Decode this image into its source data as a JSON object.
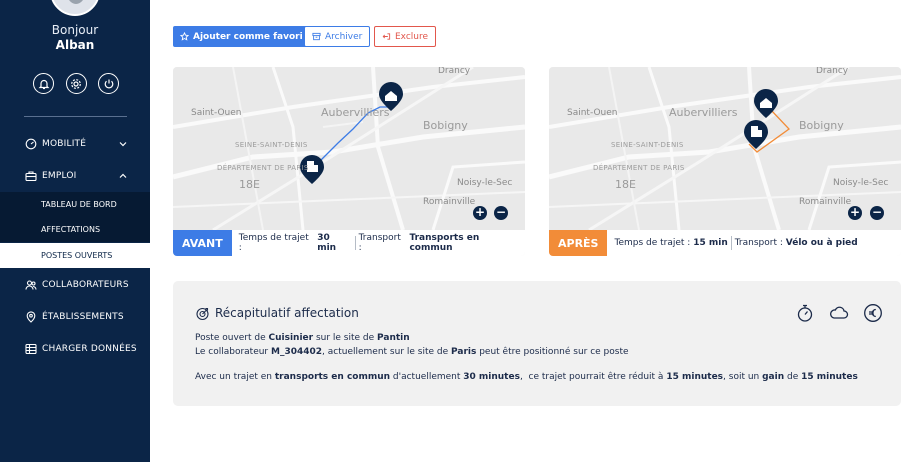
{
  "sidebar": {
    "greeting": "Bonjour",
    "user_name": "Alban",
    "menu": {
      "mobilite": "MOBILITÉ",
      "emploi": "EMPLOI",
      "tableau_de_bord": "TABLEAU DE BORD",
      "affectations": "AFFECTATIONS",
      "postes_ouverts": "POSTES OUVERTS",
      "collaborateurs": "COLLABORATEURS",
      "etablissements": "ÉTABLISSEMENTS",
      "charger_donnees": "CHARGER DONNÉES"
    }
  },
  "actions": {
    "favori": "Ajouter comme favori",
    "archiver": "Archiver",
    "exclure": "Exclure"
  },
  "map_labels": {
    "drancy": "Drancy",
    "aubervilliers": "Aubervilliers",
    "saint_ouen": "Saint-Ouen",
    "bobigny": "Bobigny",
    "seine_saint_denis": "SEINE-SAINT-DENIS",
    "departement_paris": "DÉPARTEMENT DE PARIS",
    "arr18": "18E",
    "noisy": "Noisy-le-Sec",
    "romainville": "Romainville"
  },
  "avant": {
    "tag": "AVANT",
    "time_label": "Temps de trajet : ",
    "time_value": "30 min",
    "transport_label": "Transport : ",
    "transport_value": "Transports en commun"
  },
  "apres": {
    "tag": "APRÈS",
    "time_label": "Temps de trajet : ",
    "time_value": "15 min",
    "transport_label": "Transport : ",
    "transport_value": "Vélo ou à pied"
  },
  "summary": {
    "title": "Récapitulatif affectation",
    "l1_a": "Poste ouvert de ",
    "l1_job": "Cuisinier",
    "l1_b": " sur le site de ",
    "l1_site": "Pantin",
    "l2_a": "Le collaborateur ",
    "l2_id": "M_304402",
    "l2_b": ", actuellement sur le site de ",
    "l2_site": "Paris",
    "l2_c": " peut être positionné sur ce poste",
    "l3_a": "Avec un trajet en ",
    "l3_mode": "transports en commun",
    "l3_b": " d'actuellement ",
    "l3_cur": "30 minutes",
    "l3_c": ",  ce trajet pourrait être réduit à ",
    "l3_new": "15 minutes",
    "l3_d": ", soit un ",
    "l3_gain": "gain",
    "l3_e": " de ",
    "l3_gainv": "15 minutes"
  },
  "colors": {
    "sidebar": "#0b2547",
    "accent_blue": "#3d7ce6",
    "accent_orange": "#f28c38",
    "danger": "#e2574c"
  }
}
